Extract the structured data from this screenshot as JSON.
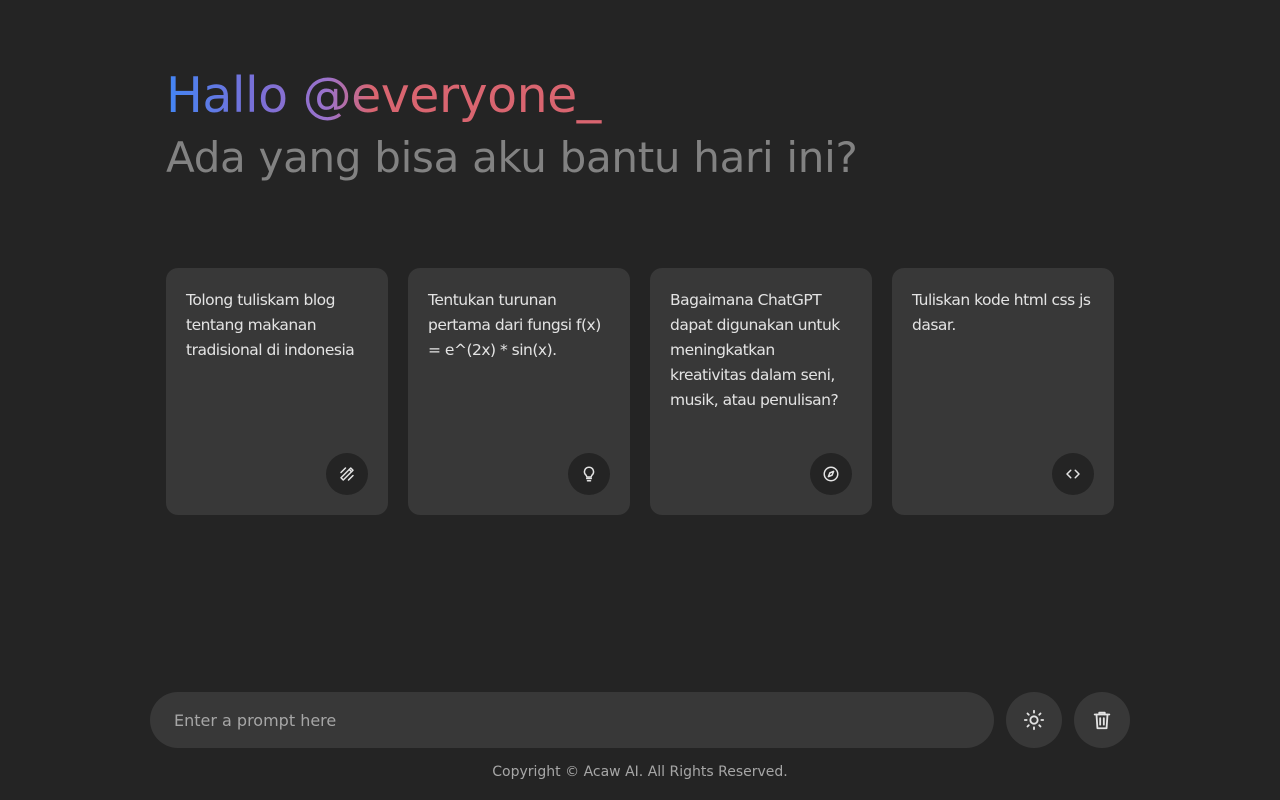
{
  "header": {
    "greeting": "Hallo @everyone_",
    "subtitle": "Ada yang bisa aku bantu hari ini?"
  },
  "suggestions": [
    {
      "text": "Tolong tuliskam blog tentang makanan tradisional di indonesia",
      "icon": "draw-icon"
    },
    {
      "text": "Tentukan turunan pertama dari fungsi f(x) = e^(2x) * sin(x).",
      "icon": "lightbulb-icon"
    },
    {
      "text": "Bagaimana ChatGPT dapat digunakan untuk meningkatkan kreativitas dalam seni, musik, atau penulisan?",
      "icon": "compass-icon"
    },
    {
      "text": "Tuliskan kode html css js dasar.",
      "icon": "code-icon"
    }
  ],
  "input": {
    "placeholder": "Enter a prompt here",
    "value": ""
  },
  "buttons": {
    "theme_icon": "sun-icon",
    "delete_icon": "trash-icon"
  },
  "footer": {
    "text": "Copyright © Acaw AI. All Rights Reserved."
  },
  "colors": {
    "background": "#242424",
    "card": "#383838",
    "gradient_start": "#4285f4",
    "gradient_mid": "#9b72cb",
    "gradient_end": "#d96570",
    "subtitle": "#828282"
  }
}
